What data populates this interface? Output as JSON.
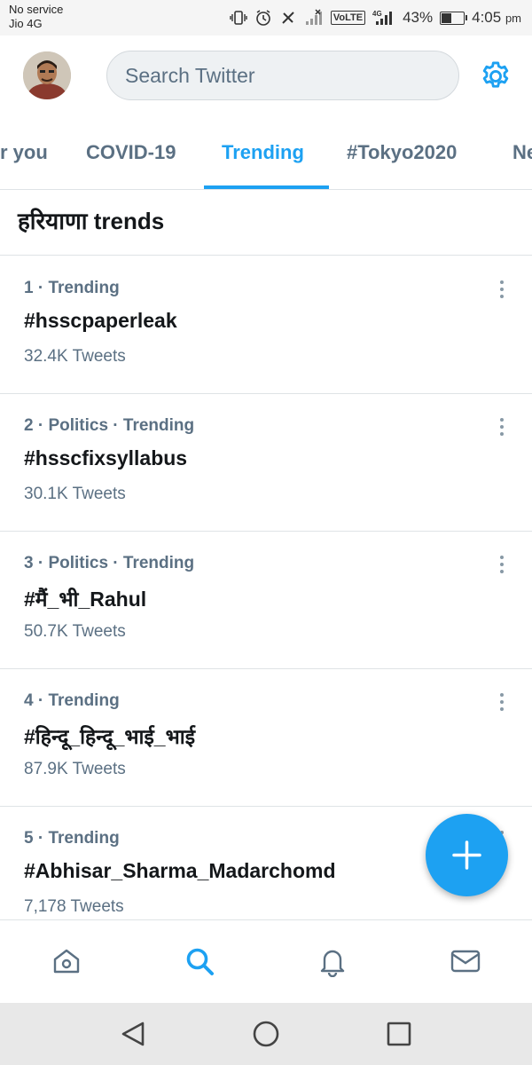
{
  "status_bar": {
    "carrier_line1": "No service",
    "carrier_line2": "Jio 4G",
    "volte": "VoLTE",
    "network": "4G",
    "battery_percent": "43%",
    "battery_level": 0.43,
    "time": "4:05",
    "ampm": "pm"
  },
  "header": {
    "search_placeholder": "Search Twitter"
  },
  "tabs": [
    {
      "label": "r you"
    },
    {
      "label": "COVID-19"
    },
    {
      "label": "Trending"
    },
    {
      "label": "#Tokyo2020"
    },
    {
      "label": "Ne"
    }
  ],
  "active_tab": "Trending",
  "section": {
    "title": "हरियाणा trends"
  },
  "trends": [
    {
      "meta": "1 · Trending",
      "name": "#hsscpaperleak",
      "count": "32.4K Tweets"
    },
    {
      "meta": "2 · Politics · Trending",
      "name": "#hsscfixsyllabus",
      "count": "30.1K Tweets"
    },
    {
      "meta": "3 · Politics · Trending",
      "name": "#मैं_भी_Rahul",
      "count": "50.7K Tweets"
    },
    {
      "meta": "4 · Trending",
      "name": "#हिन्दू_हिन्दू_भाई_भाई",
      "count": "87.9K Tweets"
    },
    {
      "meta": "5 · Trending",
      "name": "#Abhisar_Sharma_Madarchomd",
      "count": "7,178 Tweets"
    }
  ],
  "colors": {
    "accent": "#1da1f2",
    "secondary_text": "#5b7083",
    "primary_text": "#14171a"
  },
  "icons": {
    "header_right": "gear-icon",
    "fab": "plus-icon",
    "bottom_nav": [
      "home-icon",
      "search-icon",
      "bell-icon",
      "mail-icon"
    ],
    "android_nav": [
      "back-icon",
      "home-circle-icon",
      "recents-icon"
    ]
  }
}
